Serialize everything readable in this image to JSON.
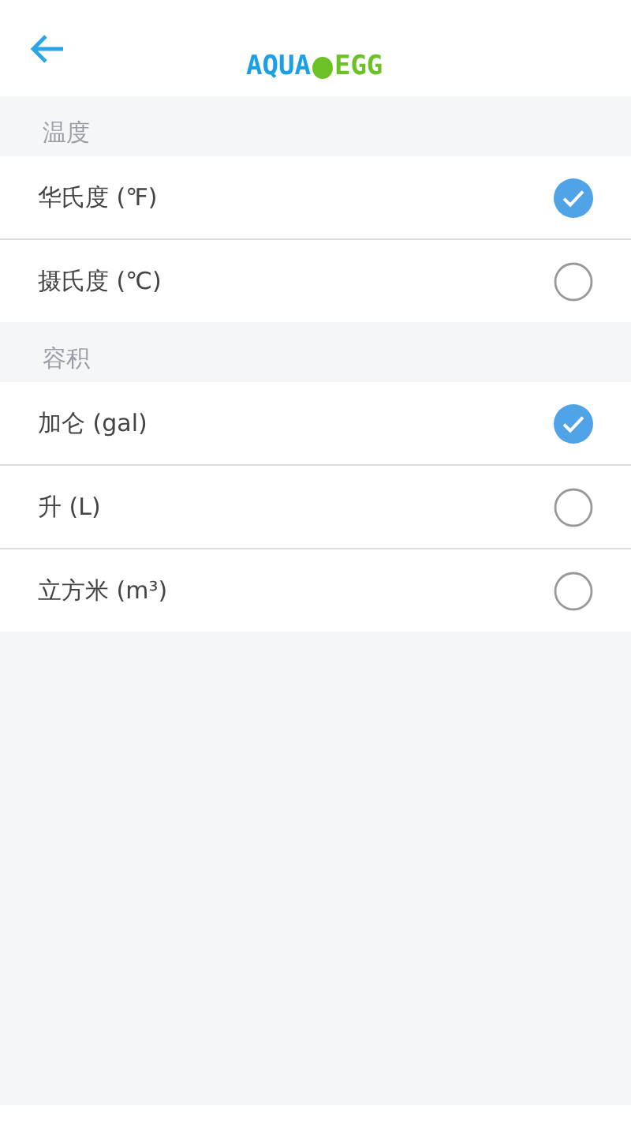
{
  "header": {
    "logo": {
      "left": "AQUA",
      "right": "EGG"
    }
  },
  "sections": [
    {
      "title": "温度",
      "options": [
        {
          "label": "华氏度 (℉)",
          "selected": true
        },
        {
          "label": "摄氏度 (℃)",
          "selected": false
        }
      ]
    },
    {
      "title": "容积",
      "options": [
        {
          "label": "加仑 (gal)",
          "selected": true
        },
        {
          "label": "升 (L)",
          "selected": false
        },
        {
          "label": "立方米 (m³)",
          "selected": false
        }
      ]
    }
  ]
}
